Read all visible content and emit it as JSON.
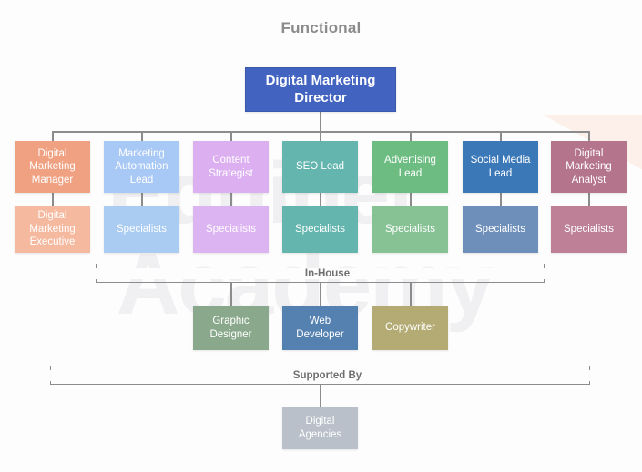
{
  "page": {
    "title": "Functional",
    "background_color": "#fdfdfd",
    "watermark_line1": "Equinet",
    "watermark_line2": "Academy"
  },
  "chart_data": {
    "type": "diagram",
    "title": "Functional",
    "subtype": "organizational-chart",
    "root": {
      "label": "Digital Marketing Director",
      "color": "#4263c0"
    },
    "columns": [
      {
        "lead": "Digital Marketing Manager",
        "lead_color": "#efa182",
        "sub": "Digital Marketing Executive",
        "sub_color": "#f5b99f"
      },
      {
        "lead": "Marketing Automation Lead",
        "lead_color": "#a8c8f5",
        "sub": "Specialists",
        "sub_color": "#aacbf2"
      },
      {
        "lead": "Content Strategist",
        "lead_color": "#dcb0f0",
        "sub": "Specialists",
        "sub_color": "#ddb4f2"
      },
      {
        "lead": "SEO Lead",
        "lead_color": "#63b5ae",
        "sub": "Specialists",
        "sub_color": "#63b5ae"
      },
      {
        "lead": "Advertising Lead",
        "lead_color": "#6dbd82",
        "sub": "Specialists",
        "sub_color": "#87c295"
      },
      {
        "lead": "Social Media Lead",
        "lead_color": "#3b78b8",
        "sub": "Specialists",
        "sub_color": "#6f8fbb"
      },
      {
        "lead": "Digital Marketing Analyst",
        "lead_color": "#b4758c",
        "sub": "Specialists",
        "sub_color": "#bd8097"
      }
    ],
    "in_house": {
      "label": "In-House",
      "nodes": [
        {
          "label": "Graphic Designer",
          "color": "#8aa98c"
        },
        {
          "label": "Web Developer",
          "color": "#5581b0"
        },
        {
          "label": "Copywriter",
          "color": "#b3ab73"
        }
      ]
    },
    "supported_by": {
      "label": "Supported By",
      "nodes": [
        {
          "label": "Digital Agencies",
          "color": "#b9c0c9"
        }
      ]
    }
  }
}
